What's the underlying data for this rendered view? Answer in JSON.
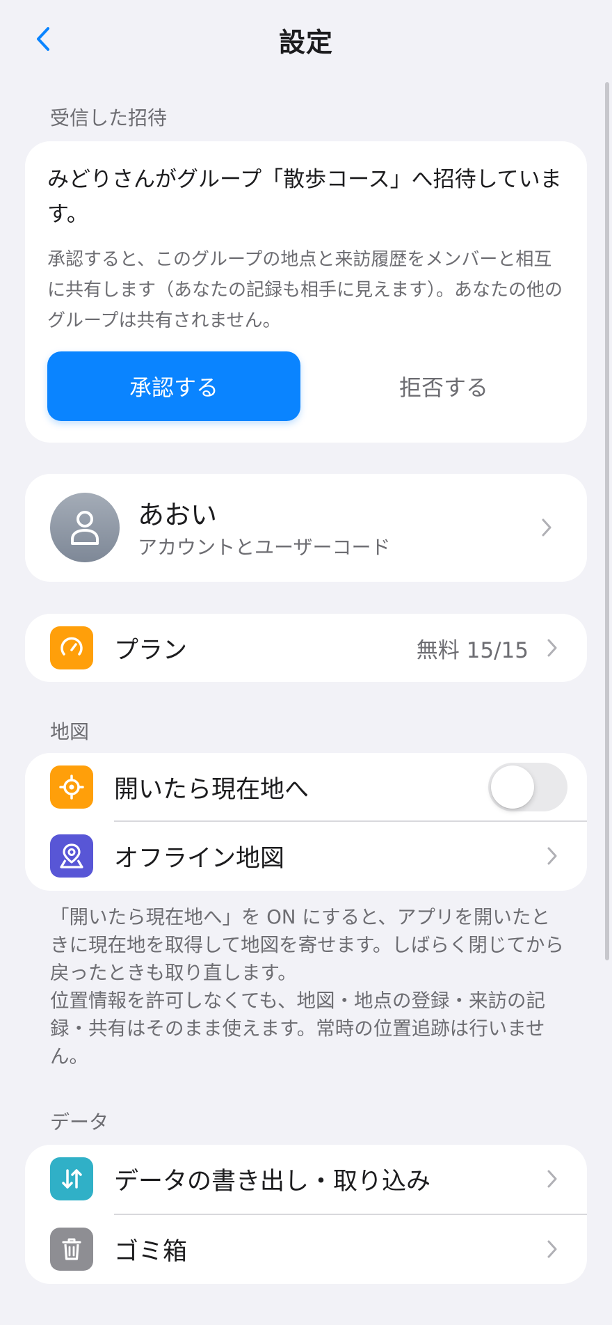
{
  "nav": {
    "title": "設定"
  },
  "invite_section": {
    "header": "受信した招待",
    "title": "みどりさんがグループ「散歩コース」へ招待しています。",
    "description": "承認すると、このグループの地点と来訪履歴をメンバーと相互に共有します（あなたの記録も相手に見えます）。あなたの他のグループは共有されません。",
    "accept_label": "承認する",
    "decline_label": "拒否する"
  },
  "profile": {
    "name": "あおい",
    "subtitle": "アカウントとユーザーコード"
  },
  "plan": {
    "label": "プラン",
    "value": "無料 15/15"
  },
  "map_section": {
    "header": "地図",
    "locate_on_open_label": "開いたら現在地へ",
    "locate_on_open_enabled": false,
    "offline_map_label": "オフライン地図",
    "footnote_lines": [
      "「開いたら現在地へ」を ON にすると、アプリを開いたときに現在地を取得して地図を寄せます。しばらく閉じてから戻ったときも取り直します。",
      "位置情報を許可しなくても、地図・地点の登録・来訪の記録・共有はそのまま使えます。常時の位置追跡は行いません。"
    ]
  },
  "data_section": {
    "header": "データ",
    "export_import_label": "データの書き出し・取り込み",
    "trash_label": "ゴミ箱"
  },
  "colors": {
    "accent": "#0a84ff",
    "plan_icon_bg": "#ff9f0a",
    "location_icon_bg": "#ff9f0a",
    "offline_map_icon_bg": "#5856d6",
    "export_icon_bg": "#30b0c7",
    "trash_icon_bg": "#8e8e93",
    "toggle_off": "#e9e9eb"
  },
  "icons": {
    "back": "chevron-left-icon",
    "avatar": "person-icon",
    "plan": "gauge-icon",
    "locate": "crosshair-icon",
    "offline_map": "map-pin-icon",
    "export_import": "arrows-up-down-icon",
    "trash": "trash-icon",
    "disclosure": "chevron-right-icon"
  }
}
